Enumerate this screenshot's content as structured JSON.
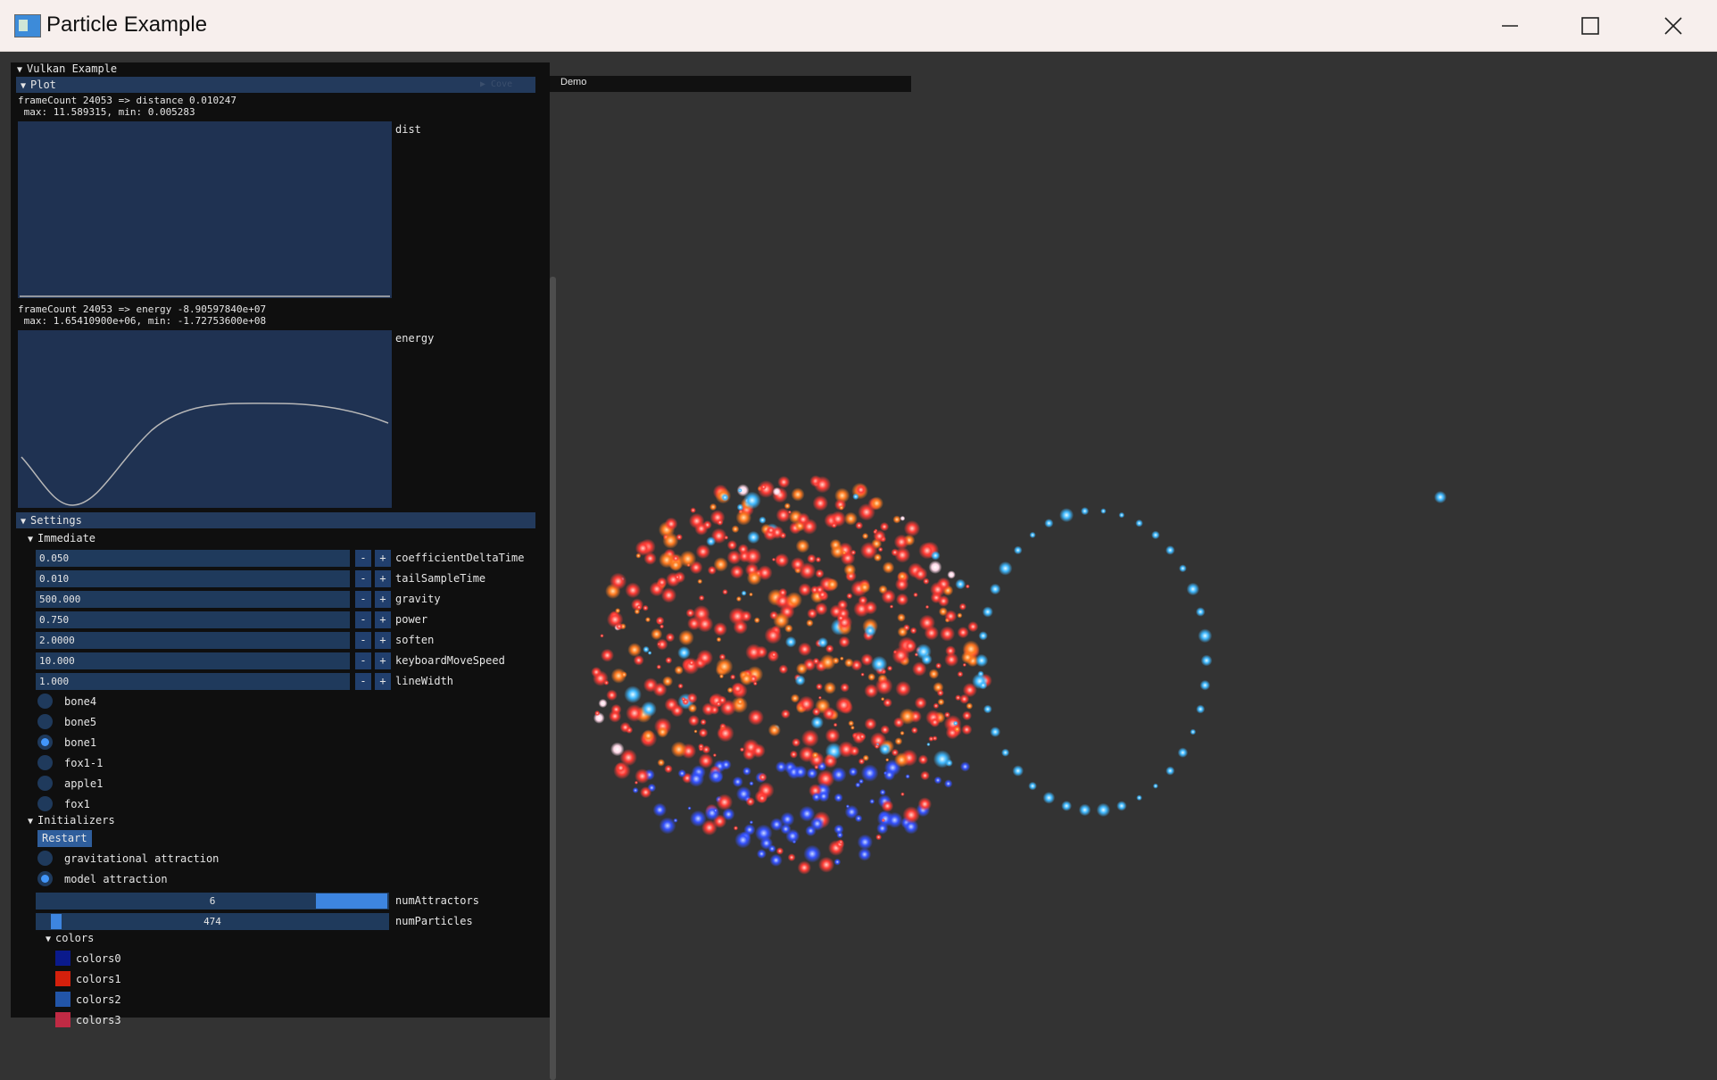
{
  "window": {
    "title": "Particle Example",
    "icon": "app-window-icon",
    "controls": [
      "minimize-icon",
      "maximize-icon",
      "close-icon"
    ]
  },
  "gui": {
    "title": "Vulkan Example",
    "plot_header": "Plot",
    "plot_header_extra": "▶ Cove",
    "demo_label": "Demo",
    "distance": {
      "caption_line1": "frameCount 24053 => distance 0.010247",
      "caption_line2": " max: 11.589315, min: 0.005283",
      "label": "dist"
    },
    "energy": {
      "caption_line1": "frameCount 24053 => energy -8.90597840e+07",
      "caption_line2": " max: 1.65410900e+06, min: -1.72753600e+08",
      "label": "energy"
    },
    "settings_header": "Settings",
    "immediate_label": "Immediate",
    "inputs": [
      {
        "value": "0.050",
        "label": "coefficientDeltaTime"
      },
      {
        "value": "0.010",
        "label": "tailSampleTime"
      },
      {
        "value": "500.000",
        "label": "gravity"
      },
      {
        "value": "0.750",
        "label": "power"
      },
      {
        "value": "2.0000",
        "label": "soften"
      },
      {
        "value": "10.000",
        "label": "keyboardMoveSpeed"
      },
      {
        "value": "1.000",
        "label": "lineWidth"
      }
    ],
    "minus": "-",
    "plus": "+",
    "models": [
      {
        "label": "bone4",
        "selected": false
      },
      {
        "label": "bone5",
        "selected": false
      },
      {
        "label": "bone1",
        "selected": true
      },
      {
        "label": "fox1-1",
        "selected": false
      },
      {
        "label": "apple1",
        "selected": false
      },
      {
        "label": "fox1",
        "selected": false
      }
    ],
    "initializers_label": "Initializers",
    "restart_label": "Restart",
    "attraction": [
      {
        "label": "gravitational attraction",
        "selected": false
      },
      {
        "label": "model attraction",
        "selected": true
      }
    ],
    "sliders": [
      {
        "value": "6",
        "label": "numAttractors",
        "fraction": 1.0
      },
      {
        "value": "474",
        "label": "numParticles",
        "fraction": 0.04
      }
    ],
    "colors_label": "colors",
    "colors": [
      {
        "label": "colors0",
        "color": "#0a1a8c"
      },
      {
        "label": "colors1",
        "color": "#d4200c"
      },
      {
        "label": "colors2",
        "color": "#2255a8"
      },
      {
        "label": "colors3",
        "color": "#c02a44"
      }
    ]
  }
}
